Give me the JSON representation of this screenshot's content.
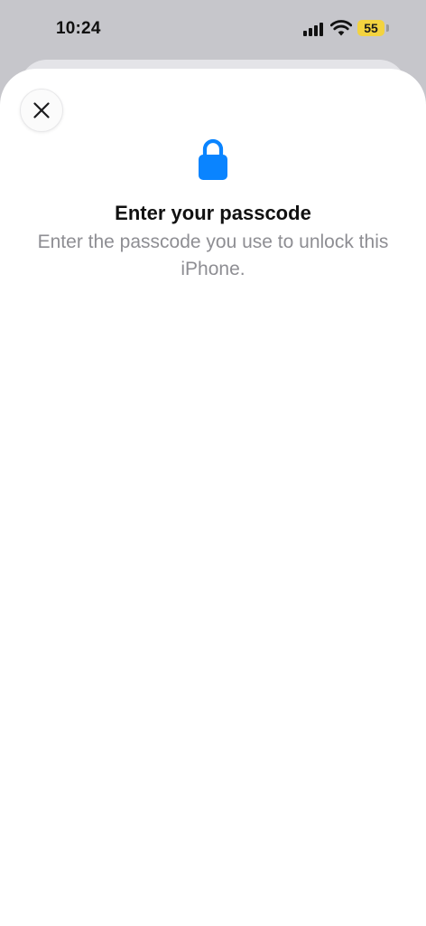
{
  "status_bar": {
    "time": "10:24",
    "battery_level": "55",
    "battery_color": "#f3d33f",
    "signal_icon": "cellular-signal-icon",
    "wifi_icon": "wifi-icon"
  },
  "sheet": {
    "close_icon": "close-icon",
    "lock_icon": "lock-icon",
    "lock_color": "#0a84ff",
    "title": "Enter your passcode",
    "subtitle": "Enter the passcode you use to unlock this iPhone."
  }
}
